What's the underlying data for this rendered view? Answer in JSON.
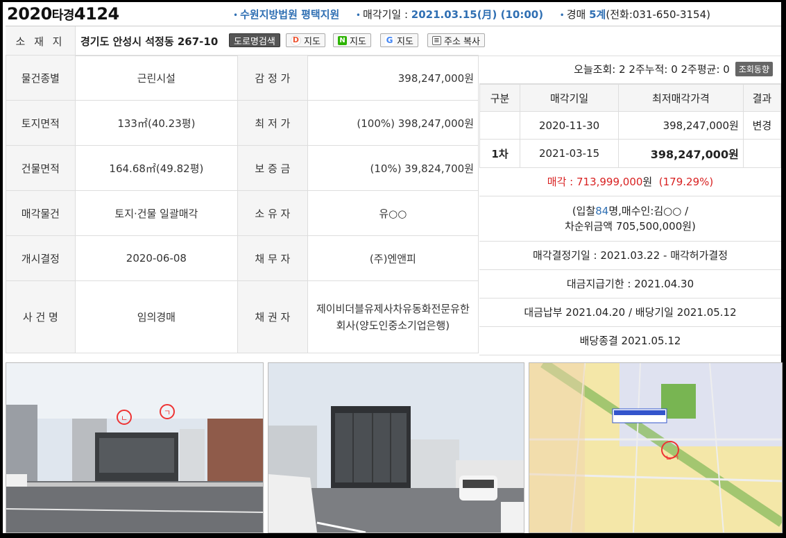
{
  "header": {
    "case_no_year": "2020",
    "case_no_type": "타경",
    "case_no_num": "4124",
    "court_dot": "•",
    "court": "수원지방법원 평택지원",
    "date_label": "매각기일 :",
    "date_value": "2021.03.15(月) (10:00)",
    "dept_label": "경매",
    "dept_value": "5계",
    "phone": "(전화:031-650-3154)"
  },
  "address": {
    "label": "소 재 지",
    "text": "경기도 안성시 석정동 267-10",
    "buttons": {
      "road_search": "도로명검색",
      "daum_map": "지도",
      "naver_map": "지도",
      "google_map": "지도",
      "copy_addr": "주소 복사"
    },
    "icons": {
      "daum": "D",
      "naver": "N",
      "google": "G"
    }
  },
  "property": {
    "rows": [
      {
        "label": "물건종별",
        "value": "근린시설",
        "label2": "감 정 가",
        "value2": "398,247,000원"
      },
      {
        "label": "토지면적",
        "value": "133㎡(40.23평)",
        "label2": "최 저 가",
        "value2": "(100%) 398,247,000원"
      },
      {
        "label": "건물면적",
        "value": "164.68㎡(49.82평)",
        "label2": "보 증 금",
        "value2": "(10%) 39,824,700원"
      },
      {
        "label": "매각물건",
        "value": "토지·건물 일괄매각",
        "label2": "소 유 자",
        "value2": "유○○"
      },
      {
        "label": "개시결정",
        "value": "2020-06-08",
        "label2": "채 무 자",
        "value2": "(주)엔앤피"
      },
      {
        "label": "사 건 명",
        "value": "임의경매",
        "label2": "채 권 자",
        "value2": "제이비더블유제사차유동화전문유한회사(양도인중소기업은행)"
      }
    ]
  },
  "stats": {
    "text": "오늘조회: 2 2주누적: 0 2주평균: 0",
    "trend_button": "조회동향"
  },
  "history": {
    "headers": [
      "구분",
      "매각기일",
      "최저매각가격",
      "결과"
    ],
    "rows": [
      {
        "round": "",
        "date": "2020-11-30",
        "price": "398,247,000원",
        "result": "변경"
      },
      {
        "round": "1차",
        "date": "2021-03-15",
        "price": "398,247,000원",
        "result": ""
      }
    ]
  },
  "sale": {
    "label": "매각 :",
    "price": "713,999,000",
    "unit": "원",
    "rate": "(179.29%)",
    "bidders_prefix": "(입찰",
    "bidders_count": "84",
    "bidders_suffix": "명,매수인:김○○ /",
    "second_bid": "차순위금액 705,500,000원)",
    "decision": "매각결정기일 : 2021.03.22 - 매각허가결정",
    "payment_deadline": "대금지급기한 : 2021.04.30",
    "paid": "대금납부 2021.04.20 / 배당기일 2021.05.12",
    "closed": "배당종결 2021.05.12"
  },
  "photos": {
    "labels": [
      "ㄴ",
      "ㄱ"
    ],
    "map_marker": "ㄴㄱ"
  },
  "colors": {
    "accent": "#2f6fb3",
    "red": "#d82020",
    "label_bg": "#f5f5f5"
  }
}
